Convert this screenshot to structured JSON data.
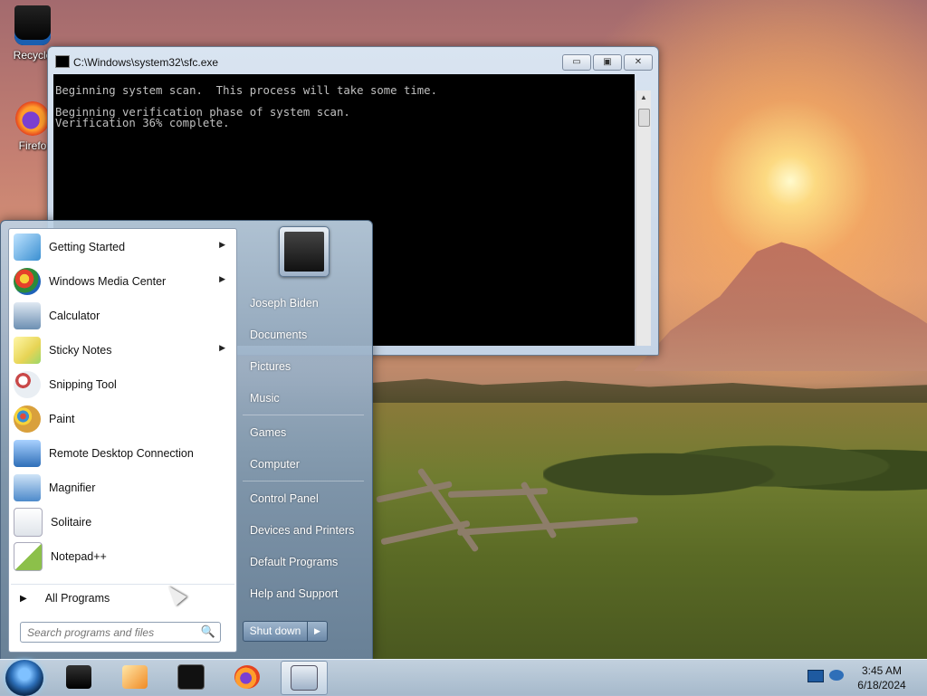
{
  "desktop": {
    "icons": [
      {
        "label": "Recycle",
        "icon": "recycle-bin-icon"
      },
      {
        "label": "Firefo",
        "icon": "firefox-icon"
      }
    ]
  },
  "cmd_window": {
    "title": "C:\\Windows\\system32\\sfc.exe",
    "buttons": {
      "minimize": "▭",
      "maximize": "▣",
      "close": "✕"
    },
    "lines": [
      "Beginning system scan.  This process will take some time.",
      "",
      "Beginning verification phase of system scan.",
      "Verification 36% complete."
    ]
  },
  "start_menu": {
    "programs": [
      {
        "label": "Getting Started",
        "icon": "getting-started-icon",
        "submenu": true,
        "color": "#3a8fd1"
      },
      {
        "label": "Windows Media Center",
        "icon": "windows-media-center-icon",
        "submenu": true,
        "color": "#2c8b3a"
      },
      {
        "label": "Calculator",
        "icon": "calculator-icon",
        "submenu": false,
        "color": "#6c8fb2"
      },
      {
        "label": "Sticky Notes",
        "icon": "sticky-notes-icon",
        "submenu": true,
        "color": "#e7d455"
      },
      {
        "label": "Snipping Tool",
        "icon": "snipping-tool-icon",
        "submenu": false,
        "color": "#c94848"
      },
      {
        "label": "Paint",
        "icon": "paint-icon",
        "submenu": false,
        "color": "#d9a03c"
      },
      {
        "label": "Remote Desktop Connection",
        "icon": "remote-desktop-icon",
        "submenu": false,
        "color": "#2f6fb8"
      },
      {
        "label": "Magnifier",
        "icon": "magnifier-icon",
        "submenu": false,
        "color": "#4d8acb"
      },
      {
        "label": "Solitaire",
        "icon": "solitaire-icon",
        "submenu": false,
        "color": "#dfe4ea"
      },
      {
        "label": "Notepad++",
        "icon": "notepadpp-icon",
        "submenu": false,
        "color": "#8cc04a"
      }
    ],
    "all_programs": "All Programs",
    "search_placeholder": "Search programs and files",
    "right_items": [
      "Joseph Biden",
      "Documents",
      "Pictures",
      "Music",
      "Games",
      "Computer",
      "Control Panel",
      "Devices and Printers",
      "Default Programs",
      "Help and Support"
    ],
    "shutdown_label": "Shut down",
    "shutdown_arrow": "▶",
    "submenu_arrow": "▶",
    "all_programs_arrow": "▶",
    "search_icon": "🔍"
  },
  "taskbar": {
    "apps": [
      {
        "name": "taskbar-app-1",
        "icon": "dark-box-icon"
      },
      {
        "name": "taskbar-media-player",
        "icon": "media-player-icon"
      },
      {
        "name": "taskbar-terminal",
        "icon": "terminal-icon"
      },
      {
        "name": "taskbar-firefox",
        "icon": "firefox-icon"
      },
      {
        "name": "taskbar-cmd-active",
        "icon": "command-window-icon"
      }
    ],
    "clock": {
      "time": "3:45 AM",
      "date": "6/18/2024"
    }
  }
}
